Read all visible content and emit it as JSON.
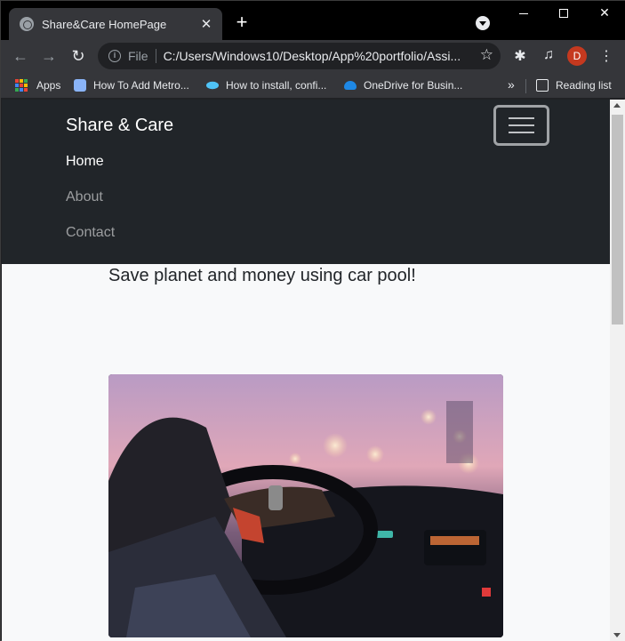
{
  "browser": {
    "tab_title": "Share&Care HomePage",
    "tab_close": "✕",
    "new_tab": "+",
    "scheme_label": "File",
    "url": "C:/Users/Windows10/Desktop/App%20portfolio/Assi...",
    "profile_initial": "D",
    "bookmarks": {
      "apps": "Apps",
      "items": [
        "How To Add Metro...",
        "How to install, confi...",
        "OneDrive for Busin..."
      ],
      "overflow": "»",
      "reading_list": "Reading list"
    }
  },
  "page": {
    "brand": "Share & Care",
    "nav": {
      "home": "Home",
      "about": "About",
      "contact": "Contact"
    },
    "tagline": "Save planet and money using car pool!"
  },
  "colors": {
    "navbar_bg": "#212529",
    "page_bg": "#f8f9fa",
    "avatar": "#c5391f"
  }
}
